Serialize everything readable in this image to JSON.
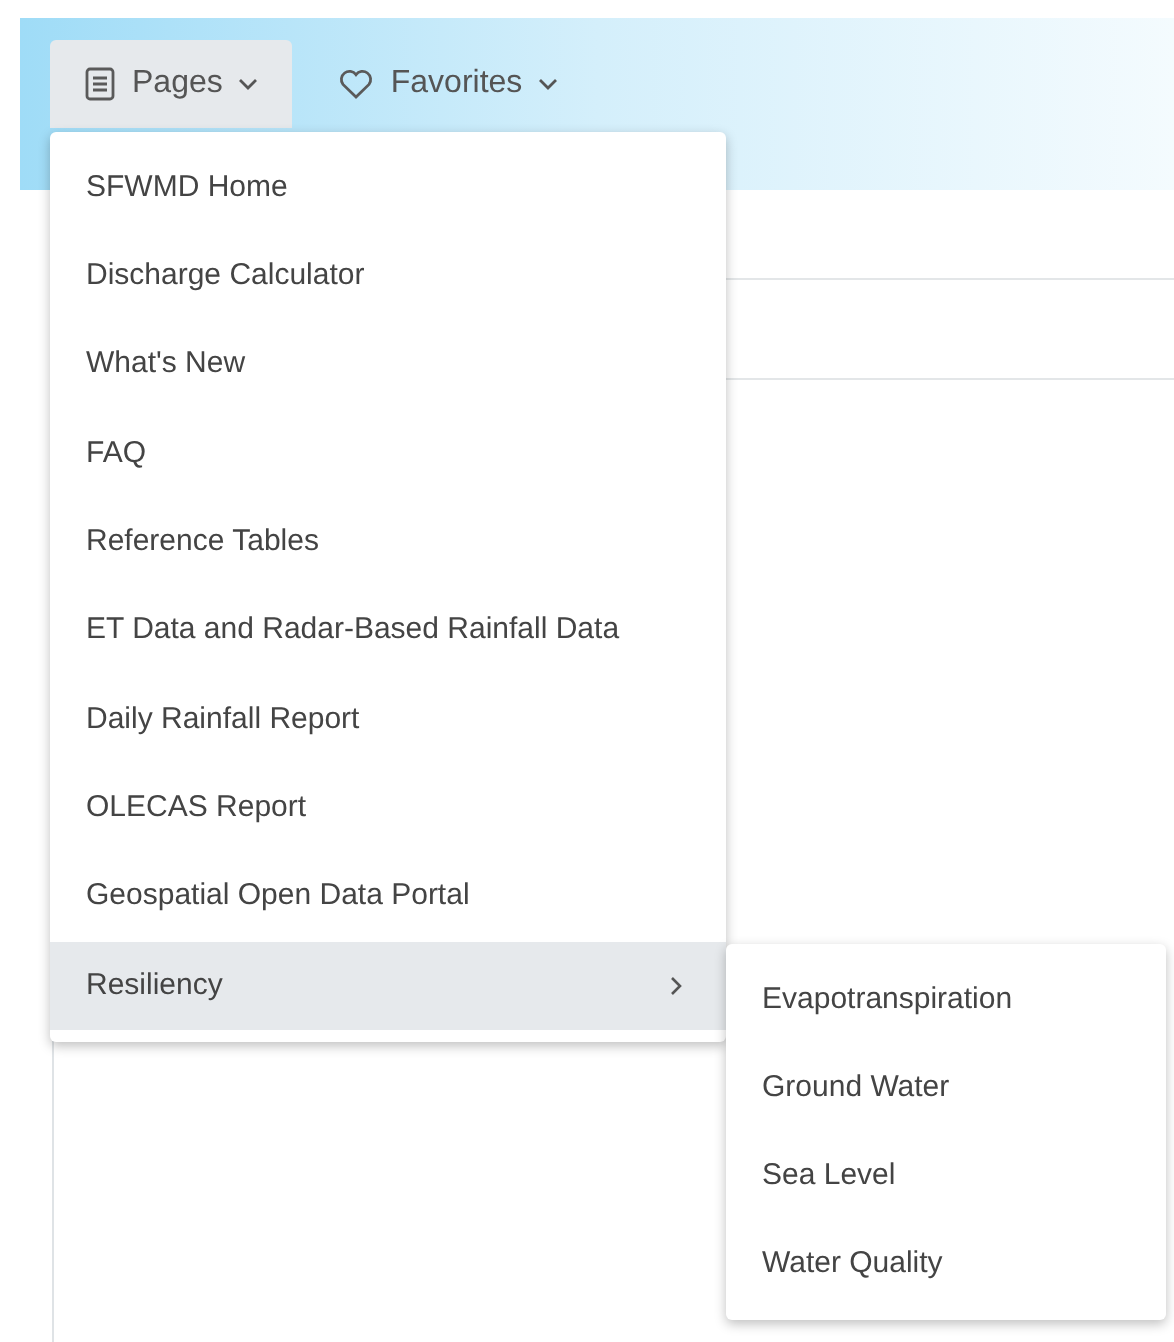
{
  "nav": [
    {
      "label": "Pages",
      "kind": "pages",
      "open": true
    },
    {
      "label": "Favorites",
      "kind": "favorites",
      "open": false
    }
  ],
  "menu": [
    {
      "label": "SFWMD Home",
      "selected": false
    },
    {
      "label": "Discharge Calculator",
      "selected": false
    },
    {
      "label": "What's New",
      "selected": false
    },
    {
      "label": "FAQ",
      "selected": false
    },
    {
      "label": "Reference Tables",
      "selected": false
    },
    {
      "label": "ET Data and Radar-Based Rainfall Data",
      "selected": false
    },
    {
      "label": "Daily Rainfall Report",
      "selected": false
    },
    {
      "label": "OLECAS Report",
      "selected": false
    },
    {
      "label": "Geospatial Open Data Portal",
      "selected": false
    },
    {
      "label": "Resiliency",
      "selected": true,
      "children": [
        {
          "label": "Evapotranspiration"
        },
        {
          "label": "Ground Water"
        },
        {
          "label": "Sea Level"
        },
        {
          "label": "Water Quality"
        }
      ]
    }
  ]
}
